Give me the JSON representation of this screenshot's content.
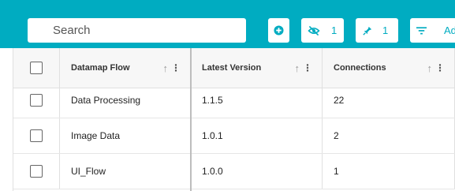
{
  "toolbar": {
    "search_placeholder": "Search",
    "add_icon": "plus-circle-icon",
    "hidden_count": "1",
    "hidden_icon": "eye-off-icon",
    "pinned_count": "1",
    "pinned_icon": "pin-icon",
    "filter_icon": "filter-icon",
    "filter_label": "Ad"
  },
  "grid": {
    "columns": [
      {
        "label": "Datamap Flow"
      },
      {
        "label": "Latest Version"
      },
      {
        "label": "Connections"
      }
    ],
    "rows": [
      {
        "flow": "Data Processing",
        "version": "1.1.5",
        "connections": "22"
      },
      {
        "flow": "Image Data",
        "version": "1.0.1",
        "connections": "2"
      },
      {
        "flow": "UI_Flow",
        "version": "1.0.0",
        "connections": "1"
      }
    ]
  },
  "colors": {
    "accent": "#00acc1",
    "header_bg": "#f7f7f7"
  }
}
